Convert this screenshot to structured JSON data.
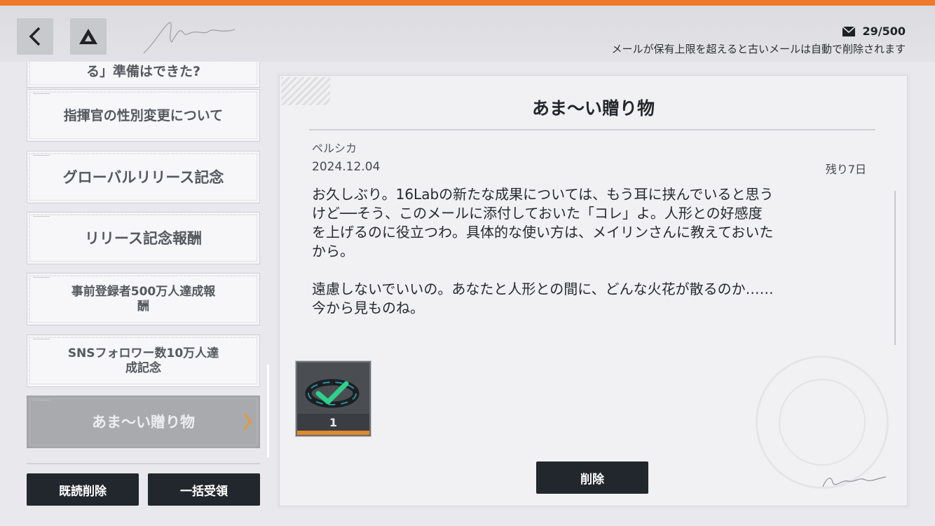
{
  "header": {
    "mail_count": "29/500",
    "notice": "メールが保有上限を超えると古いメールは自動で削除されます"
  },
  "mail_list": {
    "items": [
      {
        "label": "る」準備はできた?",
        "selected": false
      },
      {
        "label": "指揮官の性別変更について",
        "selected": false
      },
      {
        "label": "グローバルリリース記念",
        "selected": false
      },
      {
        "label": "リリース記念報酬",
        "selected": false
      },
      {
        "label": "事前登録者500万人達成報\n酬",
        "selected": false
      },
      {
        "label": "SNSフォロワー数10万人達\n成記念",
        "selected": false
      },
      {
        "label": "あま～い贈り物",
        "selected": true
      }
    ],
    "read_delete_label": "既読削除",
    "claim_all_label": "一括受領"
  },
  "mail": {
    "title": "あま～い贈り物",
    "sender": "ペルシカ",
    "date": "2024.12.04",
    "remaining": "残り7日",
    "body": "お久しぶり。16Labの新たな成果については、もう耳に挟んでいると思う\nけど──そう、このメールに添付しておいた「コレ」よ。人形との好感度\nを上げるのに役立つわ。具体的な使い方は、メイリンさんに教えておいた\nから。\n\n遠慮しないでいいの。あなたと人形との間に、どんな火花が散るのか……\n今から見ものね。",
    "reward": {
      "icon": "bracelet-item-icon",
      "quantity": "1",
      "claimed": true
    },
    "delete_label": "削除"
  },
  "colors": {
    "accent": "#ef7a2a",
    "button_bg": "#22272d",
    "selected_item": "#a8a9ad",
    "claimed_check": "#2fd08a"
  }
}
